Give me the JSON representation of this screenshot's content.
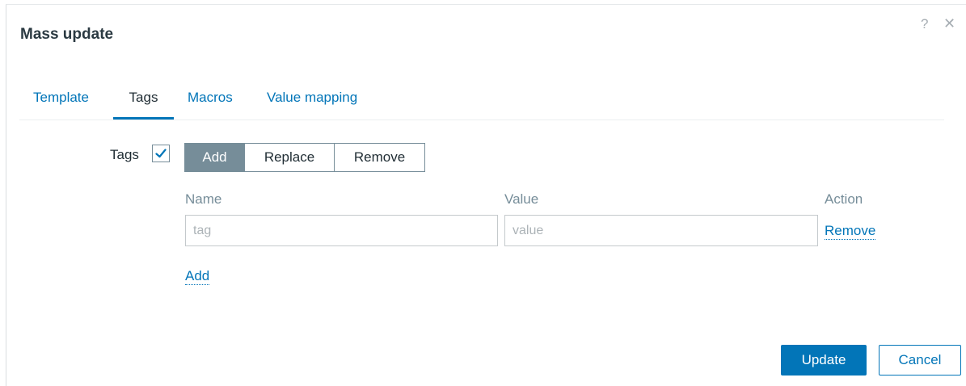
{
  "dialog": {
    "title": "Mass update",
    "help_glyph": "?",
    "close_glyph": "✕"
  },
  "tabs": [
    {
      "label": "Template",
      "active": false
    },
    {
      "label": "Tags",
      "active": true
    },
    {
      "label": "Macros",
      "active": false
    },
    {
      "label": "Value mapping",
      "active": false
    }
  ],
  "tags_section": {
    "label": "Tags",
    "checkbox_checked": true,
    "mode_buttons": [
      {
        "label": "Add",
        "selected": true
      },
      {
        "label": "Replace",
        "selected": false
      },
      {
        "label": "Remove",
        "selected": false
      }
    ],
    "columns": {
      "name": "Name",
      "value": "Value",
      "action": "Action"
    },
    "rows": [
      {
        "name_value": "",
        "name_placeholder": "tag",
        "value_value": "",
        "value_placeholder": "value",
        "action_label": "Remove"
      }
    ],
    "add_link": "Add"
  },
  "footer": {
    "update_label": "Update",
    "cancel_label": "Cancel"
  },
  "colors": {
    "accent": "#0275b8",
    "selected_segment": "#768d99",
    "muted_text": "#768d99"
  },
  "icons": [
    "help-icon",
    "close-icon",
    "checkmark-icon"
  ]
}
